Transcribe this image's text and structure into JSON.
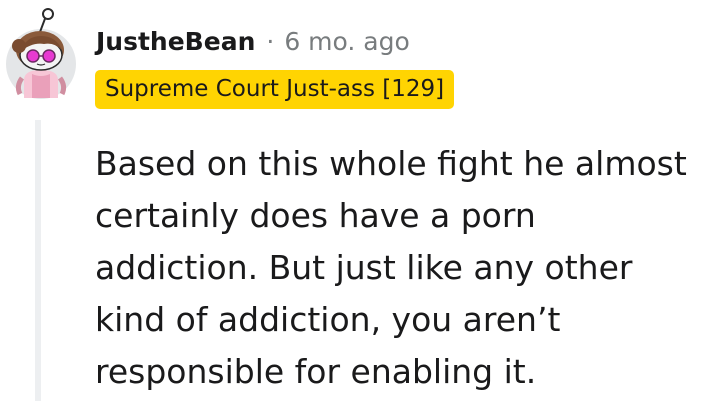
{
  "comment": {
    "author": "JustheBean",
    "separator": "·",
    "timestamp": "6 mo. ago",
    "flair": "Supreme Court Just-ass [129]",
    "body": "Based on this whole fight he almost certainly does have a porn addiction. But just like any other kind of addiction, you aren’t responsible for enabling it."
  },
  "colors": {
    "flair_bg": "#ffd402",
    "meta_text": "#787c7e",
    "text": "#1a1a1b",
    "thread_line": "#edeff1"
  },
  "icons": {
    "avatar": "snoo-avatar-with-pink-glasses"
  }
}
